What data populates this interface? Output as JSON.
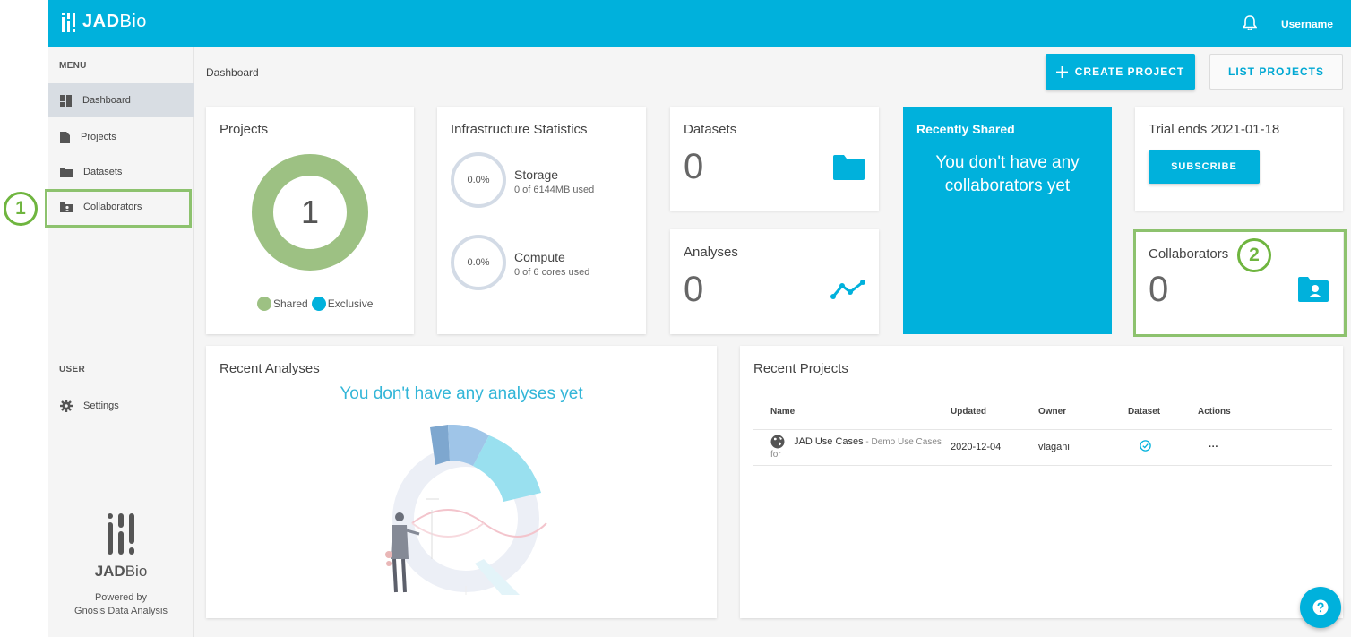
{
  "brand": {
    "name_bold": "JAD",
    "name_light": "Bio"
  },
  "header": {
    "username": "Username"
  },
  "sidebar": {
    "menu_heading": "MENU",
    "items": [
      {
        "label": "Dashboard"
      },
      {
        "label": "Projects"
      },
      {
        "label": "Datasets"
      },
      {
        "label": "Collaborators"
      }
    ],
    "user_heading": "USER",
    "settings_label": "Settings",
    "footer": {
      "brand_bold": "JAD",
      "brand_light": "Bio",
      "powered_line1": "Powered by",
      "powered_line2": "Gnosis Data Analysis"
    }
  },
  "annotations": {
    "badge1": "1",
    "badge2": "2"
  },
  "main": {
    "breadcrumb": "Dashboard",
    "create_project_label": "CREATE PROJECT",
    "list_projects_label": "LIST PROJECTS",
    "projects_card": {
      "title": "Projects",
      "count": "1",
      "legend_shared": "Shared",
      "legend_exclusive": "Exclusive",
      "shared_color": "#9dc183",
      "exclusive_color": "#00b1dc"
    },
    "infrastructure": {
      "title": "Infrastructure Statistics",
      "storage": {
        "percent": "0.0%",
        "name": "Storage",
        "usage": "0 of 6144MB used"
      },
      "compute": {
        "percent": "0.0%",
        "name": "Compute",
        "usage": "0 of 6 cores used"
      }
    },
    "datasets_card": {
      "title": "Datasets",
      "count": "0"
    },
    "analyses_card": {
      "title": "Analyses",
      "count": "0"
    },
    "recently_shared": {
      "title": "Recently Shared",
      "message": "You don't have any collaborators yet"
    },
    "trial": {
      "title": "Trial ends 2021-01-18",
      "subscribe_label": "SUBSCRIBE"
    },
    "collaborators_card": {
      "title": "Collaborators",
      "count": "0"
    },
    "recent_analyses": {
      "title": "Recent Analyses",
      "empty_message": "You don't have any analyses yet"
    },
    "recent_projects": {
      "title": "Recent Projects",
      "columns": [
        "Name",
        "Updated",
        "Owner",
        "Dataset",
        "Actions"
      ],
      "rows": [
        {
          "name": "JAD Use Cases",
          "description": " - Demo Use Cases for",
          "updated": "2020-12-04",
          "owner": "vlagani",
          "actions": "···"
        }
      ]
    }
  },
  "colors": {
    "primary": "#00b1dc",
    "annotation": "#8dc26e"
  }
}
